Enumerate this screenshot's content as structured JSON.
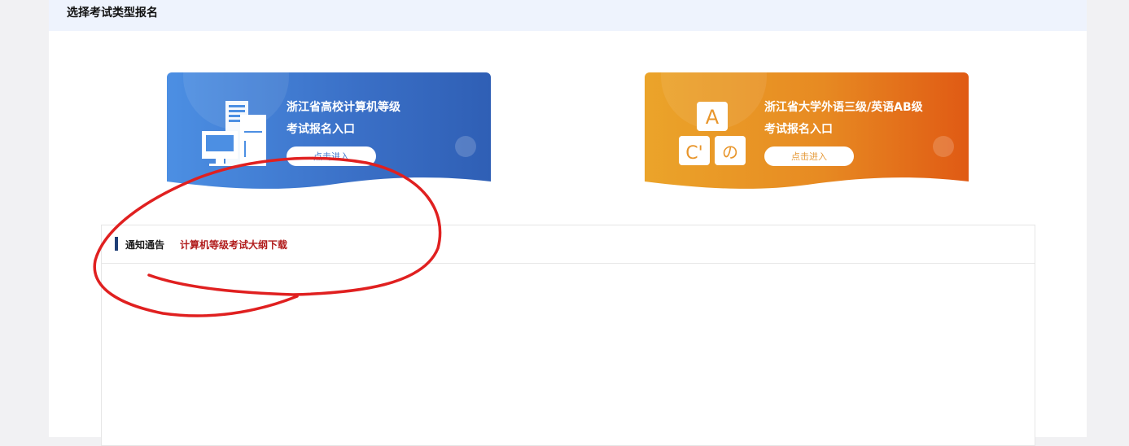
{
  "header": {
    "title": "选择考试类型报名"
  },
  "cards": [
    {
      "title_line1": "浙江省高校计算机等级",
      "title_line2": "考试报名入口",
      "button_label": "点击进入",
      "icon": "computer-icon",
      "color_start": "#4c8fe3",
      "color_end": "#2f5fb5"
    },
    {
      "title_line1": "浙江省大学外语三级/英语AB级",
      "title_line2": "考试报名入口",
      "button_label": "点击进入",
      "icon": "alphabet-blocks-icon",
      "letters": [
        "A",
        "C'",
        "の"
      ],
      "color_start": "#eba42a",
      "color_end": "#e05a14"
    }
  ],
  "notice": {
    "title": "通知通告",
    "link": "计算机等级考试大纲下载",
    "link_color": "#b11c1c"
  },
  "annotation_color": "#e02020"
}
